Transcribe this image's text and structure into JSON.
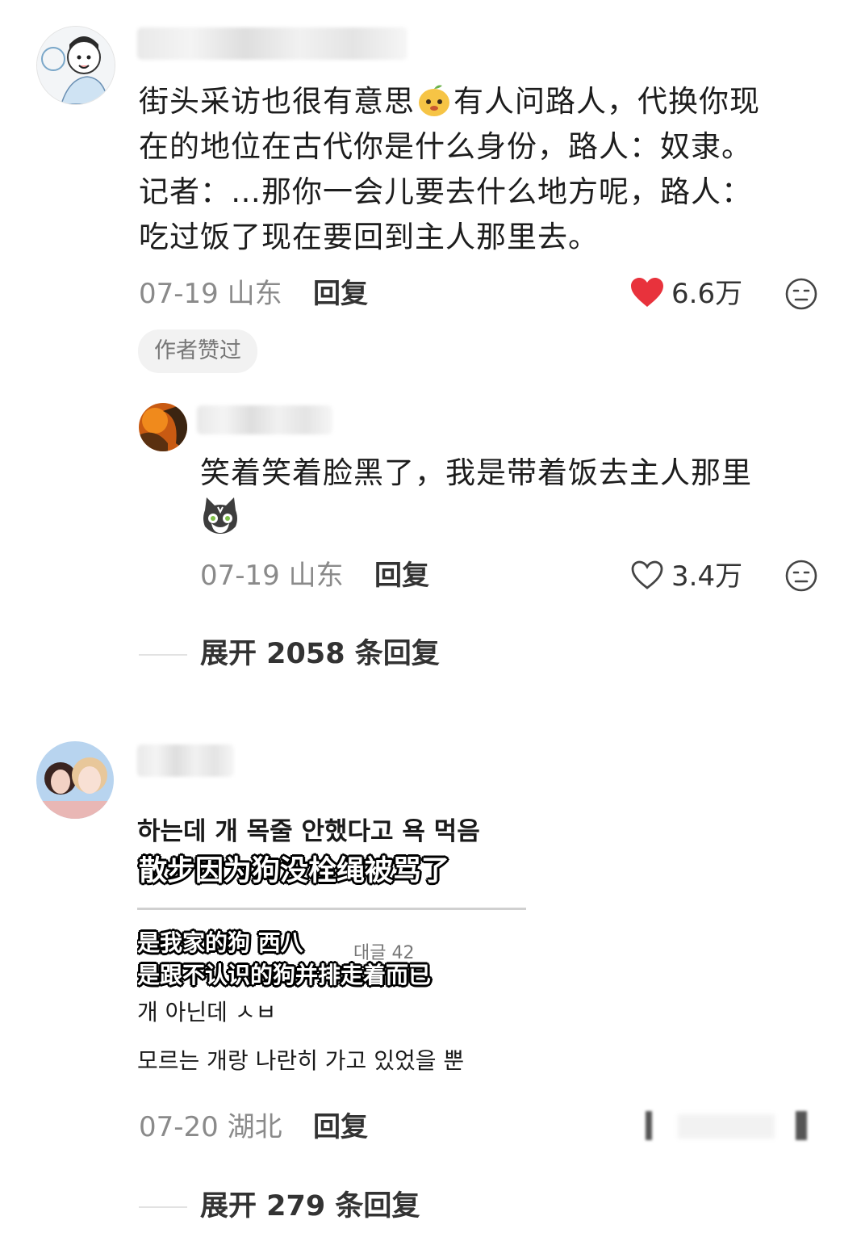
{
  "comments": [
    {
      "text_part1": "街头采访也很有意思",
      "text_part2": "有人问路人，代换你现",
      "text_line2": "在的地位在古代你是什么身份，路人：奴隶。",
      "text_line3": "记者：…那你一会儿要去什么地方呢，路人：",
      "text_line4": "吃过饭了现在要回到主人那里去。",
      "date_location": "07-19 山东",
      "reply_label": "回复",
      "likes": "6.6万",
      "badge": "作者赞过",
      "reply": {
        "text_line1": "笑着笑着脸黑了，我是带着饭去主人那里",
        "date_location": "07-19 山东",
        "reply_label": "回复",
        "likes": "3.4万"
      },
      "expand_label": "展开 2058 条回复"
    },
    {
      "image": {
        "kr_top": "하는데 개 목줄 안했다고 욕 먹음",
        "zh_top": "散步因为狗没栓绳被骂了",
        "zh_line1": "是我家的狗 西八",
        "zh_line2": "是跟不认识的狗并排走着而已",
        "kr_mid_a": "대글 42",
        "kr_mid": "개 아닌데 ㅅㅂ",
        "kr_bottom": "모르는 개랑 나란히 가고 있었을 뿐"
      },
      "date_location": "07-20 湖北",
      "reply_label": "回复",
      "expand_label": "展开 279 条回复"
    }
  ],
  "icons": {
    "like_filled_color": "#e8323c",
    "like_outline_color": "#444444"
  }
}
